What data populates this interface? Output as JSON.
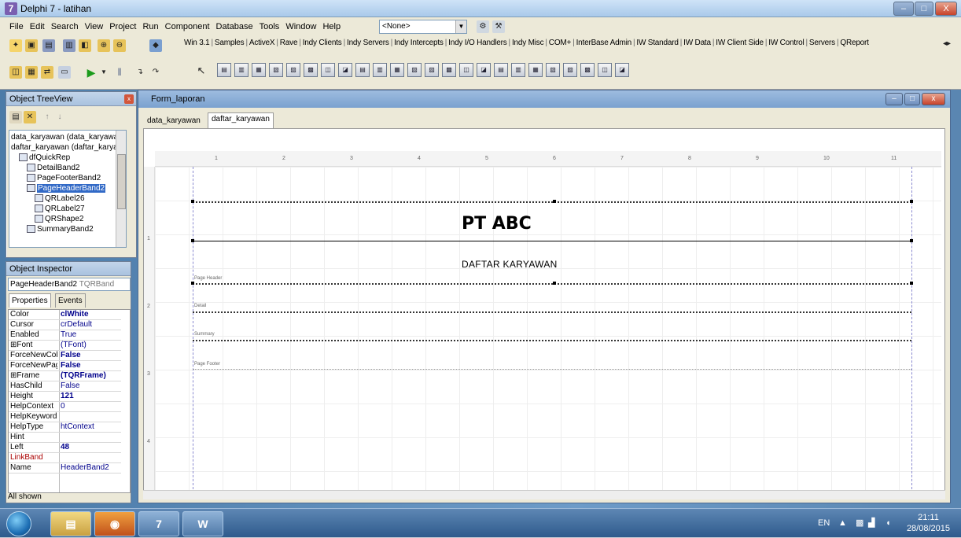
{
  "window": {
    "title": "Delphi 7 - latihan",
    "min": "–",
    "max": "□",
    "close": "X"
  },
  "menu": [
    "File",
    "Edit",
    "Search",
    "View",
    "Project",
    "Run",
    "Component",
    "Database",
    "Tools",
    "Window",
    "Help"
  ],
  "toolbar": {
    "combo_value": "<None>"
  },
  "palette_tabs": [
    "Win 3.1",
    "Samples",
    "ActiveX",
    "Rave",
    "Indy Clients",
    "Indy Servers",
    "Indy Intercepts",
    "Indy I/O Handlers",
    "Indy Misc",
    "COM+",
    "InterBase Admin",
    "IW Standard",
    "IW Data",
    "IW Client Side",
    "IW Control",
    "Servers",
    "QReport"
  ],
  "tree_view": {
    "title": "Object TreeView",
    "items": [
      {
        "label": "data_karyawan (data_karyawa",
        "indent": 0
      },
      {
        "label": "daftar_karyawan (daftar_karya",
        "indent": 0
      },
      {
        "label": "dfQuickRep",
        "indent": 1
      },
      {
        "label": "DetailBand2",
        "indent": 2
      },
      {
        "label": "PageFooterBand2",
        "indent": 2
      },
      {
        "label": "PageHeaderBand2",
        "indent": 2,
        "selected": true
      },
      {
        "label": "QRLabel26",
        "indent": 3
      },
      {
        "label": "QRLabel27",
        "indent": 3
      },
      {
        "label": "QRShape2",
        "indent": 3
      },
      {
        "label": "SummaryBand2",
        "indent": 2
      }
    ]
  },
  "inspector": {
    "title": "Object Inspector",
    "selected_name": "PageHeaderBand2",
    "selected_type": "TQRBand",
    "tab_properties": "Properties",
    "tab_events": "Events",
    "rows": [
      {
        "name": "Color",
        "value": "clWhite",
        "bold": true
      },
      {
        "name": "Cursor",
        "value": "crDefault"
      },
      {
        "name": "Enabled",
        "value": "True"
      },
      {
        "name": "⊞Font",
        "value": "(TFont)"
      },
      {
        "name": "ForceNewColu",
        "value": "False",
        "bold": true
      },
      {
        "name": "ForceNewPage",
        "value": "False",
        "bold": true
      },
      {
        "name": "⊞Frame",
        "value": "(TQRFrame)",
        "bold": true
      },
      {
        "name": "HasChild",
        "value": "False"
      },
      {
        "name": "Height",
        "value": "121",
        "bold": true
      },
      {
        "name": "HelpContext",
        "value": "0"
      },
      {
        "name": "HelpKeyword",
        "value": ""
      },
      {
        "name": "HelpType",
        "value": "htContext"
      },
      {
        "name": "Hint",
        "value": ""
      },
      {
        "name": "Left",
        "value": "48",
        "bold": true
      },
      {
        "name": "LinkBand",
        "value": "",
        "red": true
      },
      {
        "name": "Name",
        "value": "HeaderBand2"
      }
    ],
    "status": "All shown"
  },
  "form": {
    "title": "Form_laporan",
    "tabs": [
      "data_karyawan",
      "daftar_karyawan"
    ],
    "active_tab": 1,
    "ruler_h": [
      "1",
      "2",
      "3",
      "4",
      "5",
      "6",
      "7",
      "8",
      "9",
      "10",
      "11"
    ],
    "ruler_v": [
      "1",
      "2",
      "3",
      "4"
    ],
    "report_title": "PT ABC",
    "report_subtitle": "DAFTAR KARYAWAN",
    "band_labels": {
      "header": "Page Header",
      "detail": "Detail",
      "summary": "Summary",
      "footer": "Page Footer"
    }
  },
  "taskbar": {
    "lang": "EN",
    "time": "21:11",
    "date": "28/08/2015"
  }
}
